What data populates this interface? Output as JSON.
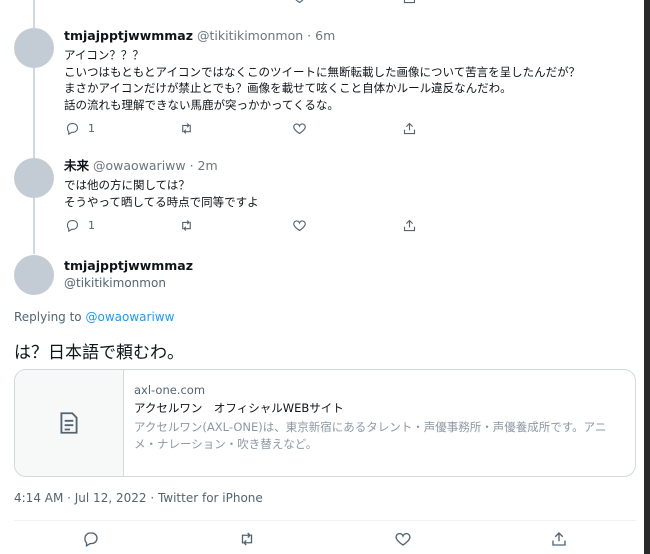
{
  "replies": [
    {
      "name": "tmjajpptjwwmmaz",
      "handle": "@tikitikimonmon",
      "time": "· 6m",
      "lines": [
        "アイコン？？？",
        "こいつはもともとアイコンではなくこのツイートに無断転載した画像について苦言を呈したんだが？",
        "まさかアイコンだけが禁止とでも？画像を載せて呟くこと自体かルール違反なんだわ。",
        "話の流れも理解できない馬鹿が突っかかってくるな。"
      ],
      "reply_count": "1"
    },
    {
      "name": "未来",
      "handle": "@owaowariww",
      "time": "· 2m",
      "lines": [
        "では他の方に関しては？",
        "そうやって晒してる時点で同等ですよ"
      ],
      "reply_count": "1"
    }
  ],
  "main": {
    "name": "tmjajpptjwwmmaz",
    "handle": "@tikitikimonmon",
    "replying_prefix": "Replying to",
    "replying_to": "@owaowariww",
    "text": "は？日本語で頼むわ。",
    "card": {
      "domain": "axl-one.com",
      "title": "アクセルワン　オフィシャルWEBサイト",
      "desc_line1": "アクセルワン(AXL-ONE)は、東京新宿にあるタレント・声優事務所・声優養成所です。アニ",
      "desc_line2": "メ・ナレーション・吹き替えなど。"
    },
    "timestamp": "4:14 AM · Jul 12, 2022 · Twitter for iPhone"
  },
  "icons": {
    "reply": "reply-icon",
    "retweet": "retweet-icon",
    "like": "like-icon",
    "share": "share-icon",
    "card": "document-icon"
  },
  "colors": {
    "link": "#1d9bf0",
    "muted": "#536471",
    "avatar": "#c3ccd4"
  }
}
